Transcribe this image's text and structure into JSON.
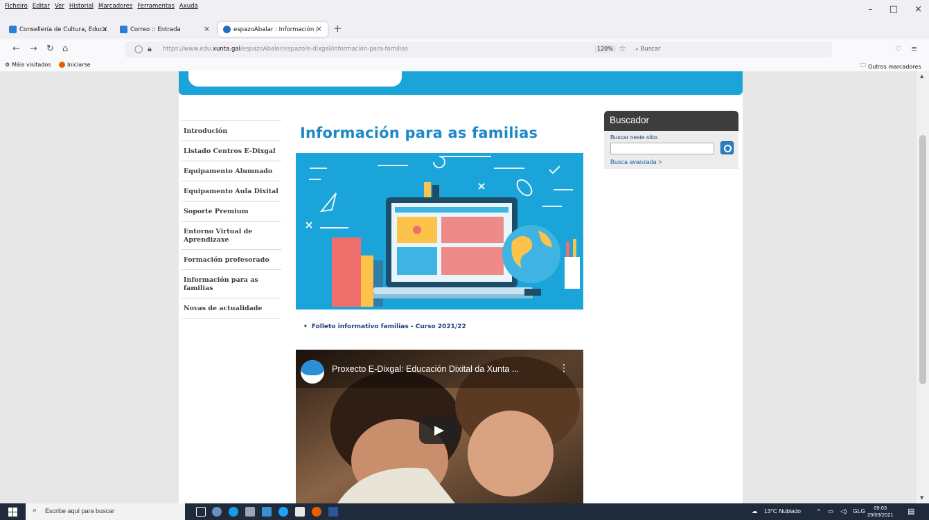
{
  "menubar": {
    "items": [
      "Ficheiro",
      "Editar",
      "Ver",
      "Historial",
      "Marcadores",
      "Ferramentas",
      "Axuda"
    ],
    "window_controls": [
      "–",
      "□",
      "×"
    ]
  },
  "tabs": [
    {
      "label": "Consellería de Cultura, Educació",
      "icon": "xunta-icon",
      "color": "#2c7fd0"
    },
    {
      "label": "Correo :: Entrada",
      "icon": "mail-icon",
      "color": "#2c7fd0"
    },
    {
      "label": "espazoAbalar : Información par",
      "icon": "edge-icon",
      "color": "#1e6fc0",
      "active": true
    }
  ],
  "navbar": {
    "url_prefix": "https://www.edu.",
    "url_domain": "xunta.gal",
    "url_path": "/espazoAbalar/espazo/e-dixgal/informacion-para-familias",
    "zoom": "120%",
    "search_placeholder": "Buscar"
  },
  "bookmarks": {
    "most_visited": "Máis visitados",
    "get_started": "Iniciarse",
    "other": "Outros marcadores"
  },
  "page": {
    "title": "Información para as familias",
    "left_nav": [
      "Introdución",
      "Listado Centros E-Dixgal",
      "Equipamento Alumnado",
      "Equipamento Aula Dixital",
      "Soporte Premium",
      "Entorno Virtual de Aprendizaxe",
      "Formación profesorado",
      "Información para as familias",
      "Novas de actualidade"
    ],
    "doc_link": "Folleto informativo familias - Curso 2021/22",
    "video_title": "Proxecto E-Dixgal: Educación Dixital da Xunta ...",
    "search_box": {
      "title": "Buscador",
      "label": "Buscar neste sitio:",
      "value": "",
      "advanced": "Busca avanzada >"
    }
  },
  "taskbar": {
    "search_placeholder": "Escribe aquí para buscar",
    "weather": "13°C  Nublado",
    "lang": "GLG",
    "time": "09:03",
    "date": "29/09/2021"
  },
  "colors": {
    "brand_blue": "#1aa4d9",
    "title_blue": "#1e88c7",
    "link_navy": "#1f3f7a"
  }
}
